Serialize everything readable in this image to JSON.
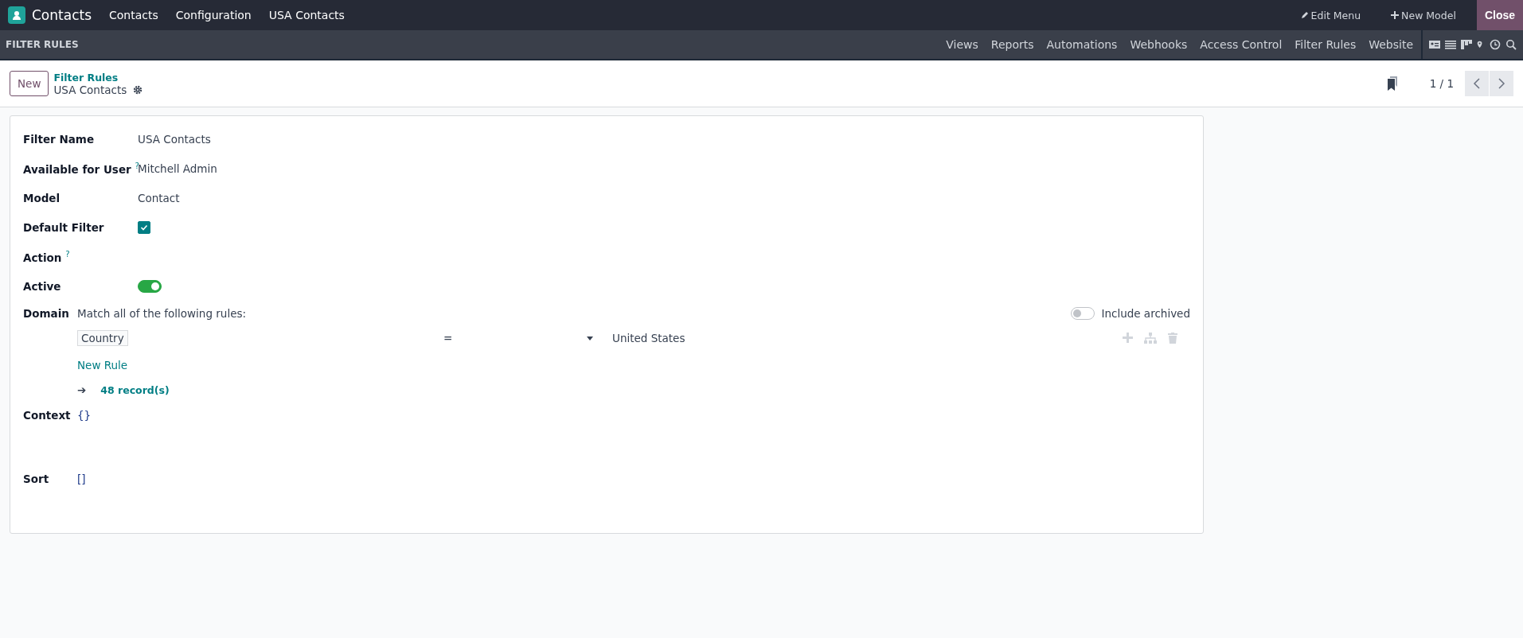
{
  "navbar": {
    "app_name": "Contacts",
    "menus": [
      "Contacts",
      "Configuration",
      "USA Contacts"
    ],
    "edit_menu": "Edit Menu",
    "new_model": "New Model",
    "close": "Close"
  },
  "studio_bar": {
    "title": "FILTER RULES",
    "tabs": [
      {
        "label": "Views",
        "selected": false
      },
      {
        "label": "Reports",
        "selected": false
      },
      {
        "label": "Automations",
        "selected": false
      },
      {
        "label": "Webhooks",
        "selected": false
      },
      {
        "label": "Access Control",
        "selected": false
      },
      {
        "label": "Filter Rules",
        "selected": false
      },
      {
        "label": "Website",
        "selected": false
      }
    ]
  },
  "control_panel": {
    "new_button": "New",
    "breadcrumb": "Filter Rules",
    "record_title": "USA Contacts",
    "pager": "1 / 1"
  },
  "form": {
    "fields": [
      {
        "kind": "text",
        "label": "Filter Name",
        "value": "USA Contacts"
      },
      {
        "kind": "text",
        "label": "Available for User",
        "help": "?",
        "value": "Mitchell Admin"
      },
      {
        "kind": "text",
        "label": "Model",
        "value": "Contact"
      },
      {
        "kind": "checkbox",
        "label": "Default Filter",
        "checked": true
      },
      {
        "kind": "empty",
        "label": "Action",
        "help": "?"
      },
      {
        "kind": "toggle",
        "label": "Active",
        "on": true
      }
    ],
    "domain": {
      "label": "Domain",
      "match_text": "Match all of the following rules:",
      "include_archived": {
        "label": "Include archived",
        "on": false
      },
      "rules": [
        {
          "field": "Country",
          "operator": "=",
          "value": "United States"
        }
      ],
      "new_rule": "New Rule",
      "arrow": "➔",
      "records": "48 record(s)"
    },
    "code_fields": [
      {
        "label": "Context",
        "value": "{}"
      },
      {
        "label": "Sort",
        "value": "[]"
      }
    ]
  }
}
